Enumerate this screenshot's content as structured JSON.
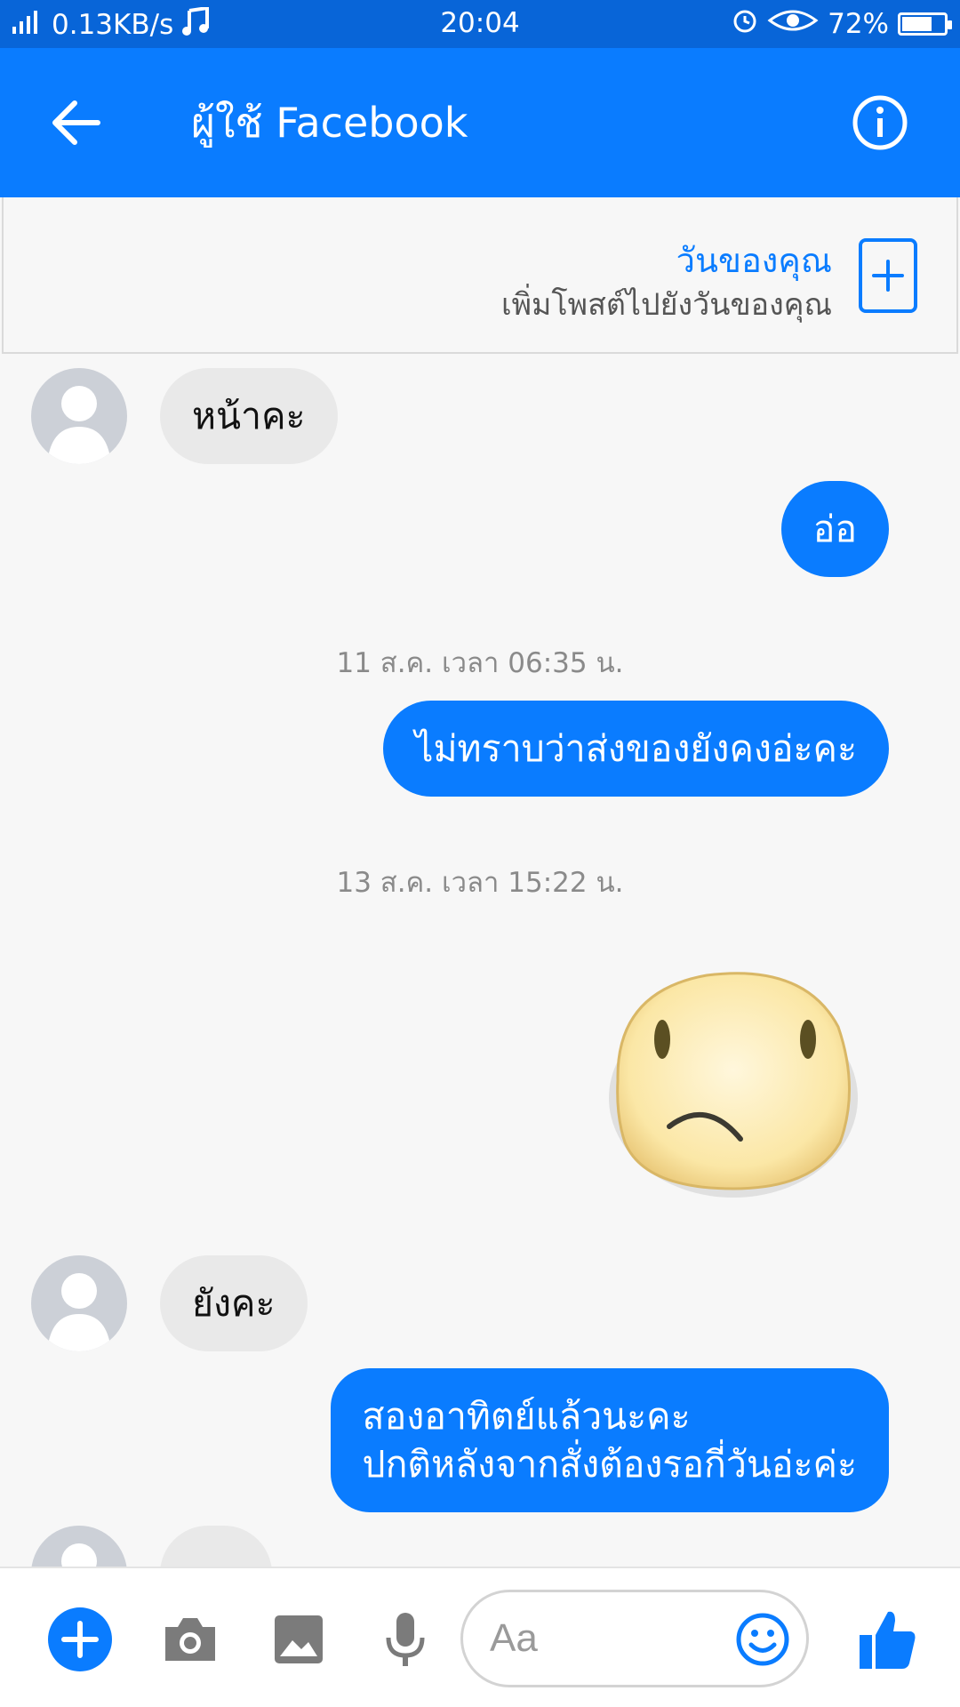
{
  "status_bar": {
    "network_speed": "0.13KB/s",
    "time": "20:04",
    "battery": "72%",
    "battery_level": 0.72
  },
  "header": {
    "title": "ผู้ใช้ Facebook"
  },
  "story": {
    "title": "วันของคุณ",
    "subtitle": "เพิ่มโพสต์ไปยังวันของคุณ"
  },
  "messages": [
    {
      "from": "other",
      "text": "หน้าคะ"
    },
    {
      "from": "me",
      "text": "อ่อ"
    },
    {
      "type": "timestamp",
      "text": "11 ส.ค. เวลา 06:35 น."
    },
    {
      "from": "me",
      "text": "ไม่ทราบว่าส่งของยังคงอ่ะคะ"
    },
    {
      "type": "timestamp",
      "text": "13 ส.ค. เวลา 15:22 น."
    },
    {
      "from": "me",
      "type": "sticker",
      "icon": "sad-face-sticker"
    },
    {
      "from": "other",
      "text": "ยังคะ"
    },
    {
      "from": "me",
      "lines": [
        "สองอาทิตย์แล้วนะคะ",
        "ปกติหลังจากสั่งต้องรอกี่วันอ่ะค่ะ"
      ]
    }
  ],
  "composer": {
    "placeholder": "Aa"
  },
  "colors": {
    "brand_blue": "#0a7cff",
    "status_blue": "#0865d8",
    "incoming_bubble": "#e9e9e9"
  }
}
